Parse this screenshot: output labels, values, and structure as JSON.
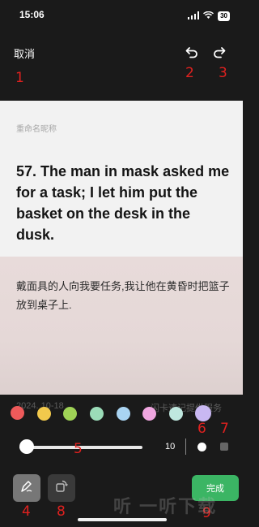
{
  "status_bar": {
    "time": "15:06",
    "battery": "30"
  },
  "toolbar": {
    "cancel_label": "取消"
  },
  "card": {
    "rename_placeholder": "重命名昵称",
    "english": "57. The man in mask asked me for a task; I let him put the basket on the desk in the dusk.",
    "chinese": "戴面具的人向我要任务,我让他在黄昏时把篮子放到桌子上.",
    "date": "2024. 10-18",
    "provider": "闪卡速记提供服务"
  },
  "palette": {
    "colors": [
      "#ee5a5a",
      "#f2c94c",
      "#9fd356",
      "#9bdcb8",
      "#a9d4f2",
      "#f0a6e0",
      "#bfe8df",
      "#c9b8f2"
    ]
  },
  "brush": {
    "size_value": "10",
    "level": 0.0
  },
  "actions": {
    "done_label": "完成"
  },
  "watermark": "听 一听下载",
  "markers": {
    "m1": "1",
    "m2": "2",
    "m3": "3",
    "m4": "4",
    "m5": "5",
    "m6": "6",
    "m7": "7",
    "m8": "8",
    "m9": "9"
  }
}
